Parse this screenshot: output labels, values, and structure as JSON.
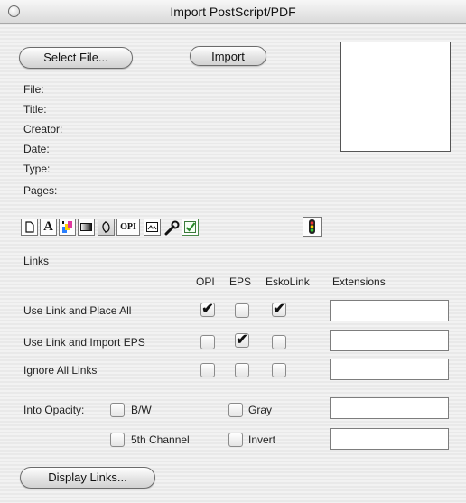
{
  "window": {
    "title": "Import PostScript/PDF"
  },
  "buttons": {
    "select_file": "Select File...",
    "import": "Import",
    "display_links": "Display Links..."
  },
  "info_labels": [
    "File:",
    "Title:",
    "Creator:",
    "Date:",
    "Type:",
    "Pages:"
  ],
  "toolbar": {
    "icons": [
      "document-icon",
      "font-icon",
      "color-swatch-icon",
      "gradient-icon",
      "link-icon",
      "opi-icon",
      "image-icon",
      "wrench-icon",
      "checkmark-icon"
    ],
    "text_font": "A",
    "text_opi": "OPI"
  },
  "links": {
    "heading": "Links",
    "columns": [
      "OPI",
      "EPS",
      "EskoLink",
      "Extensions"
    ],
    "rows": [
      {
        "label": "Use Link and Place All",
        "opi": true,
        "eps": false,
        "esko": true,
        "extensions": ""
      },
      {
        "label": "Use Link and Import EPS",
        "opi": false,
        "eps": true,
        "esko": false,
        "extensions": ""
      },
      {
        "label": "Ignore All Links",
        "opi": false,
        "eps": false,
        "esko": false,
        "extensions": ""
      }
    ]
  },
  "opacity": {
    "label": "Into Opacity:",
    "options": [
      {
        "label": "B/W",
        "checked": false
      },
      {
        "label": "Gray",
        "checked": false
      },
      {
        "label": "5th Channel",
        "checked": false
      },
      {
        "label": "Invert",
        "checked": false
      }
    ],
    "extensions": [
      "",
      ""
    ]
  },
  "check_glyph": "✔"
}
